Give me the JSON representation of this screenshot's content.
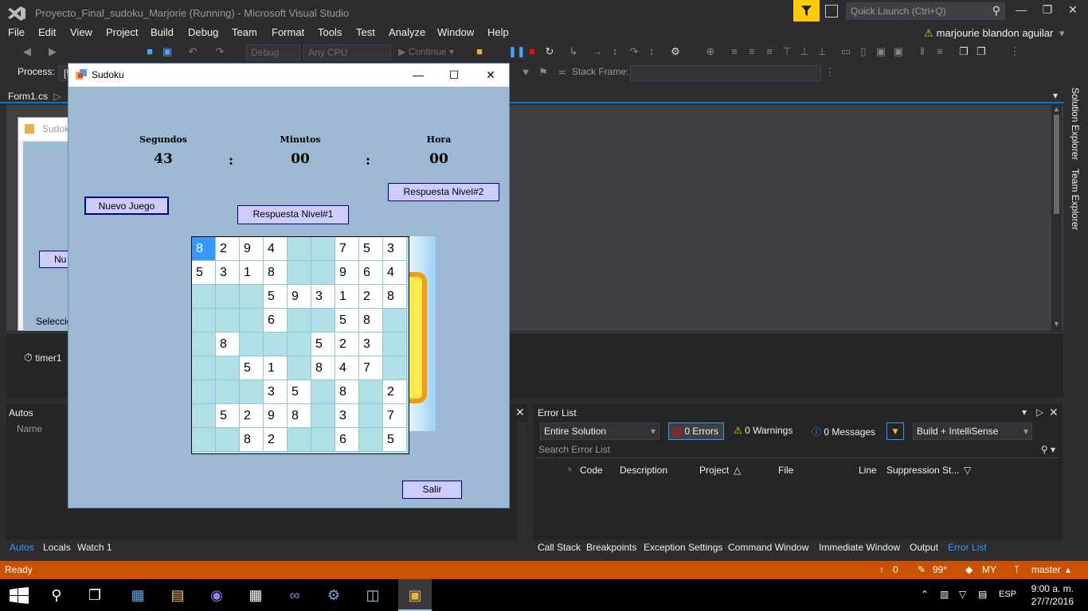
{
  "vs": {
    "title": "Proyecto_Final_sudoku_Marjorie (Running) - Microsoft Visual Studio",
    "quick_launch": "Quick Launch (Ctrl+Q)",
    "user": "marjourie blandon aguilar",
    "menu": [
      "File",
      "Edit",
      "View",
      "Project",
      "Build",
      "Debug",
      "Team",
      "Format",
      "Tools",
      "Test",
      "Analyze",
      "Window",
      "Help"
    ],
    "toolbar": {
      "config": "Debug",
      "platform": "Any CPU",
      "continue": "Continue",
      "process_label": "Process:",
      "process_value": "[5",
      "stack_frame": "Stack Frame:"
    },
    "doc_tab": "Form1.cs",
    "design_partial": {
      "title": "Sudok",
      "button": "Nu",
      "label": "Seleccio"
    },
    "component_tray": {
      "timer": "timer1"
    },
    "right_tabs": [
      "Solution Explorer",
      "Team Explorer"
    ],
    "autos": {
      "title": "Autos",
      "column": "Name"
    },
    "error_list": {
      "title": "Error List",
      "scope": "Entire Solution",
      "errors": "0 Errors",
      "warnings": "0 Warnings",
      "messages": "0 Messages",
      "build_filter": "Build + IntelliSense",
      "search": "Search Error List",
      "columns": [
        "Code",
        "Description",
        "Project",
        "File",
        "Line",
        "Suppression St..."
      ]
    },
    "bottom_tabs_left": [
      "Autos",
      "Locals",
      "Watch 1"
    ],
    "bottom_tabs_right": [
      "Call Stack",
      "Breakpoints",
      "Exception Settings",
      "Command Window",
      "Immediate Window",
      "Output",
      "Error List"
    ],
    "status": {
      "text": "Ready",
      "up": "0",
      "edits": "99*",
      "repo": "MY",
      "branch": "master"
    },
    "clock": {
      "time": "9:00 a. m.",
      "date": "27/7/2016",
      "lang": "ESP"
    }
  },
  "sudoku": {
    "title": "Sudoku",
    "labels": {
      "segundos": "Segundos",
      "minutos": "Minutos",
      "hora": "Hora"
    },
    "timer": {
      "seconds": "43",
      "minutes": "00",
      "hours": "00",
      "sep": ":"
    },
    "buttons": {
      "nuevo": "Nuevo Juego",
      "nivel1": "Respuesta Nivel#1",
      "nivel2": "Respuesta Nivel#2",
      "salir": "Salir"
    },
    "grid": [
      [
        "8",
        "2",
        "9",
        "4",
        "",
        "",
        "7",
        "5",
        "3"
      ],
      [
        "5",
        "3",
        "1",
        "8",
        "",
        "",
        "9",
        "6",
        "4"
      ],
      [
        "",
        "",
        "",
        "5",
        "9",
        "3",
        "1",
        "2",
        "8"
      ],
      [
        "",
        "",
        "",
        "6",
        "",
        "",
        "5",
        "8",
        ""
      ],
      [
        "",
        "8",
        "",
        "",
        "",
        "5",
        "2",
        "3",
        ""
      ],
      [
        "",
        "",
        "5",
        "1",
        "",
        "8",
        "4",
        "7",
        ""
      ],
      [
        "",
        "",
        "",
        "3",
        "5",
        "",
        "8",
        "",
        "2"
      ],
      [
        "",
        "5",
        "2",
        "9",
        "8",
        "",
        "3",
        "",
        "7"
      ],
      [
        "",
        "",
        "8",
        "2",
        "",
        "",
        "6",
        "",
        "5"
      ]
    ],
    "selected_cell": "0,0"
  }
}
